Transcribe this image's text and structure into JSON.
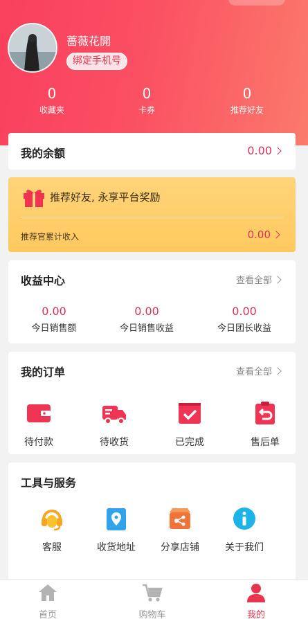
{
  "profile": {
    "username": "蔷薇花開",
    "bind_button": "绑定手机号",
    "stats": [
      {
        "value": "0",
        "label": "收藏夹"
      },
      {
        "value": "0",
        "label": "卡券"
      },
      {
        "value": "0",
        "label": "推荐好友"
      }
    ]
  },
  "balance": {
    "label": "我的余额",
    "amount": "0.00"
  },
  "promo": {
    "text": "推荐好友, 永享平台奖励",
    "income_label": "推荐官累计收入",
    "income_value": "0.00"
  },
  "earnings": {
    "title": "收益中心",
    "more": "查看全部",
    "items": [
      {
        "value": "0.00",
        "label": "今日销售额"
      },
      {
        "value": "0.00",
        "label": "今日销售收益"
      },
      {
        "value": "0.00",
        "label": "今日团长收益"
      }
    ]
  },
  "orders": {
    "title": "我的订单",
    "more": "查看全部",
    "items": [
      {
        "label": "待付款",
        "icon": "wallet-icon"
      },
      {
        "label": "待收货",
        "icon": "truck-icon"
      },
      {
        "label": "已完成",
        "icon": "check-box-icon"
      },
      {
        "label": "售后单",
        "icon": "return-clipboard-icon"
      }
    ]
  },
  "tools": {
    "title": "工具与服务",
    "items": [
      {
        "label": "客服",
        "icon": "headset-icon"
      },
      {
        "label": "收货地址",
        "icon": "location-icon"
      },
      {
        "label": "分享店铺",
        "icon": "share-store-icon"
      },
      {
        "label": "关于我们",
        "icon": "info-icon"
      }
    ]
  },
  "tabbar": {
    "items": [
      {
        "label": "首页",
        "icon": "home-icon",
        "active": false
      },
      {
        "label": "购物车",
        "icon": "cart-icon",
        "active": false
      },
      {
        "label": "我的",
        "icon": "user-icon",
        "active": true
      }
    ]
  },
  "colors": {
    "accent": "#e8344f",
    "amount": "#d8325a",
    "header_start": "#f9405e",
    "promo": "#ffc95e"
  }
}
